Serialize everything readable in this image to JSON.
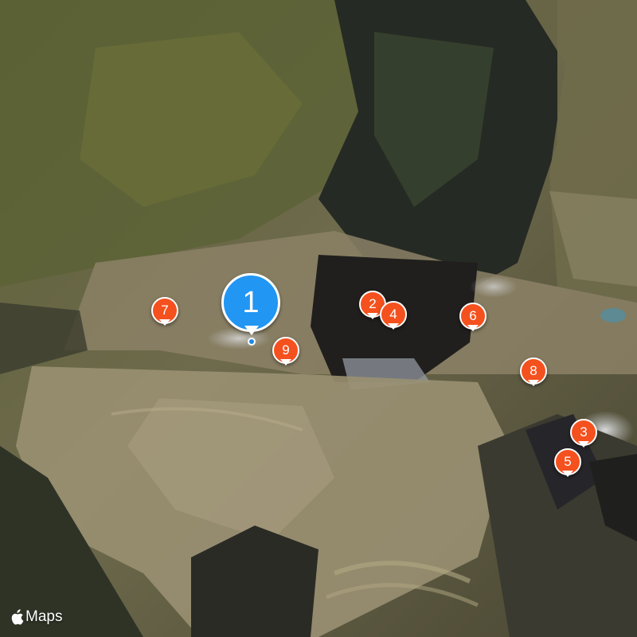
{
  "map": {
    "type": "satellite",
    "attribution_text": "Maps",
    "attribution_logo": "apple-logo-icon"
  },
  "colors": {
    "primary_pin": "#2196f3",
    "secondary_pin": "#f4511e",
    "location_dot": "#1e88e5"
  },
  "markers": [
    {
      "label": "1",
      "kind": "primary",
      "icon": "map-pin-icon"
    },
    {
      "label": "2",
      "kind": "secondary",
      "icon": "map-pin-icon"
    },
    {
      "label": "3",
      "kind": "secondary",
      "icon": "map-pin-icon"
    },
    {
      "label": "4",
      "kind": "secondary",
      "icon": "map-pin-icon"
    },
    {
      "label": "5",
      "kind": "secondary",
      "icon": "map-pin-icon"
    },
    {
      "label": "6",
      "kind": "secondary",
      "icon": "map-pin-icon"
    },
    {
      "label": "7",
      "kind": "secondary",
      "icon": "map-pin-icon"
    },
    {
      "label": "8",
      "kind": "secondary",
      "icon": "map-pin-icon"
    },
    {
      "label": "9",
      "kind": "secondary",
      "icon": "map-pin-icon"
    }
  ]
}
